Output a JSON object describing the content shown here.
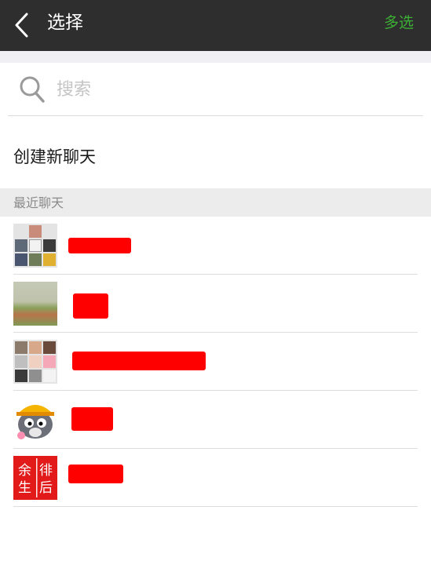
{
  "header": {
    "title": "选择",
    "multi_select_label": "多选"
  },
  "search": {
    "placeholder": "搜索"
  },
  "new_chat": {
    "label": "创建新聊天"
  },
  "recent": {
    "section_label": "最近聊天",
    "items": [
      {
        "avatar": "group-photo-grid-avatar",
        "name_redacted": true
      },
      {
        "avatar": "landscape-photo-avatar",
        "name_redacted": true
      },
      {
        "avatar": "group-photo-grid-avatar",
        "name_redacted": true
      },
      {
        "avatar": "cartoon-wolf-avatar",
        "name_redacted": true
      },
      {
        "avatar": "red-seal-avatar",
        "name_redacted": true
      }
    ],
    "seal_text": "余生 徘后"
  },
  "colors": {
    "header_bg": "#2e2e2e",
    "accent_green": "#3cb034",
    "redaction": "#ff0000"
  }
}
